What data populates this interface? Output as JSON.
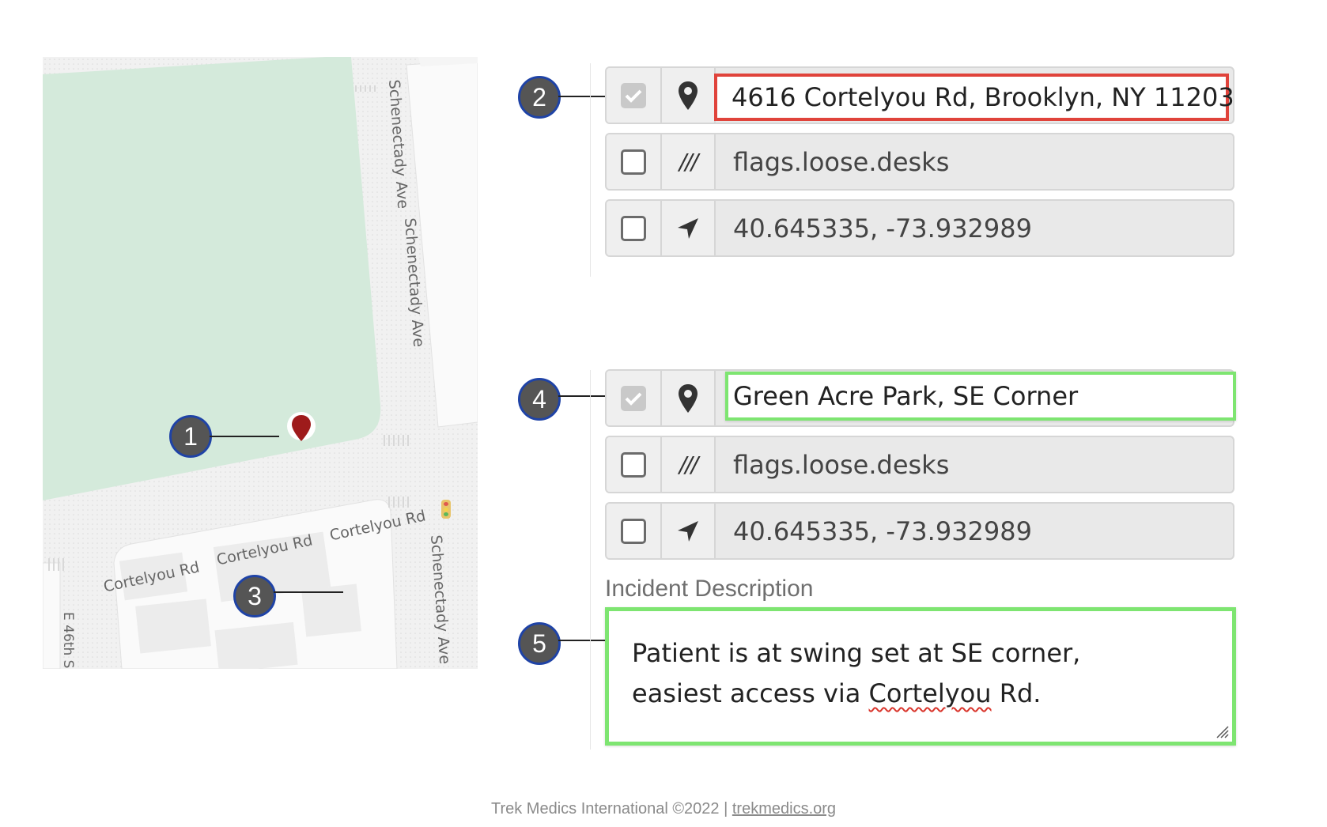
{
  "map": {
    "streets": {
      "schenectady_north": "Schenectady Ave",
      "schenectady_mid": "Schenectady Ave",
      "schenectady_south": "Schenectady Ave",
      "cortelyou_west": "Cortelyou Rd",
      "cortelyou_mid": "Cortelyou Rd",
      "cortelyou_east": "Cortelyou Rd",
      "e46th": "E 46th S"
    },
    "colors": {
      "park": "#d4eadb",
      "road": "#f2f2f2",
      "block": "#fafafa",
      "building": "#eaeaea",
      "pin": "#9e1b1b"
    }
  },
  "callouts": [
    "1",
    "2",
    "3",
    "4",
    "5"
  ],
  "groups": [
    {
      "rows": [
        {
          "checked": true,
          "icon": "map-marker-icon",
          "value": "4616 Cortelyou Rd, Brooklyn, NY 11203",
          "highlight": "#e0433b"
        },
        {
          "checked": false,
          "icon": "what3words-icon",
          "icon_text": "///",
          "value": "flags.loose.desks"
        },
        {
          "checked": false,
          "icon": "location-arrow-icon",
          "value": "40.645335, -73.932989"
        }
      ]
    },
    {
      "rows": [
        {
          "checked": true,
          "icon": "map-marker-icon",
          "value": "Green Acre Park, SE Corner",
          "highlight": "#7ee571"
        },
        {
          "checked": false,
          "icon": "what3words-icon",
          "icon_text": "///",
          "value": "flags.loose.desks"
        },
        {
          "checked": false,
          "icon": "location-arrow-icon",
          "value": "40.645335, -73.932989"
        }
      ]
    }
  ],
  "incident": {
    "label": "Incident Description",
    "line1": "Patient is at swing set at SE corner,",
    "line2_pre": "easiest access via ",
    "line2_word": "Cortelyou",
    "line2_post": " Rd."
  },
  "footer": {
    "text": "Trek Medics International ©2022 | ",
    "link": "trekmedics.org"
  }
}
